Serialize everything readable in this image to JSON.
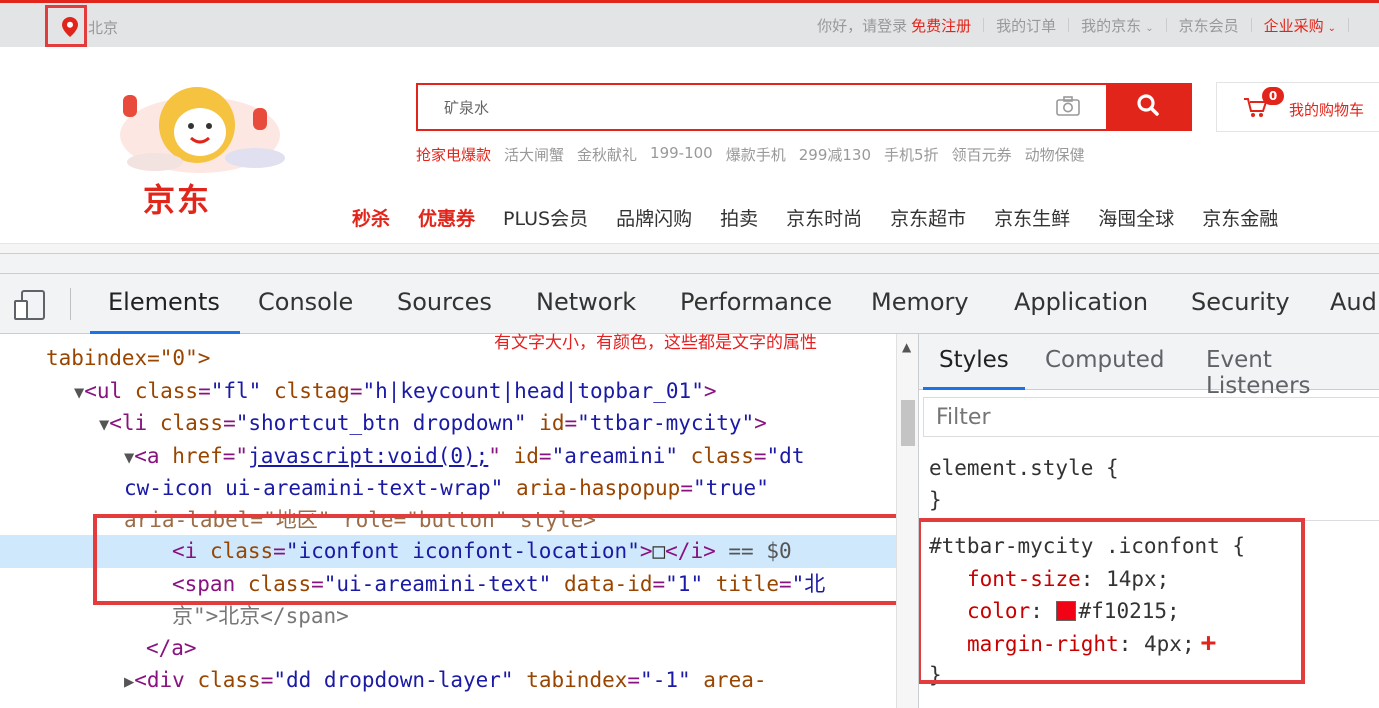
{
  "jd": {
    "city": "北京",
    "topnav": {
      "greeting": "你好，请登录",
      "register": "免费注册",
      "orders": "我的订单",
      "my_jd": "我的京东",
      "member": "京东会员",
      "enterprise": "企业采购"
    },
    "logo_text": "京东",
    "search": {
      "value": "矿泉水"
    },
    "cart": {
      "badge": "0",
      "label": "我的购物车"
    },
    "hotwords": [
      "抢家电爆款",
      "活大闸蟹",
      "金秋献礼",
      "199-100",
      "爆款手机",
      "299减130",
      "手机5折",
      "领百元券",
      "动物保健"
    ],
    "nav": [
      "秒杀",
      "优惠券",
      "PLUS会员",
      "品牌闪购",
      "拍卖",
      "京东时尚",
      "京东超市",
      "京东生鲜",
      "海囤全球",
      "京东金融"
    ]
  },
  "devtools": {
    "tabs": [
      "Elements",
      "Console",
      "Sources",
      "Network",
      "Performance",
      "Memory",
      "Application",
      "Security",
      "Audi"
    ],
    "annotation": "有文字大小，有颜色，这些都是文字的属性",
    "elements": {
      "l0": "tabindex=\"0\">",
      "ul_tag": "<ul",
      "ul_class_attr": "class",
      "ul_class_val": "\"fl\"",
      "ul_clstag_attr": "clstag",
      "ul_clstag_val": "\"h|keycount|head|topbar_01\"",
      "li_tag": "<li",
      "li_class_attr": "class",
      "li_class_val": "\"shortcut_btn dropdown\"",
      "li_id_attr": "id",
      "li_id_val": "\"ttbar-mycity\"",
      "a_tag": "<a",
      "a_href_attr": "href",
      "a_href_val": "javascript:void(0);",
      "a_id_attr": "id",
      "a_id_val": "\"areamini\"",
      "a_class_attr": "class",
      "a_class_val1": "\"dt",
      "a_class_val2": "cw-icon ui-areamini-text-wrap\"",
      "a_aria_attr": "aria-haspopup",
      "a_aria_val": "\"true\"",
      "a_label_line": "aria-label=\"地区\" role=\"button\" style>",
      "i_tag": "<i",
      "i_class_attr": "class",
      "i_class_val": "\"iconfont iconfont-location\"",
      "i_close": "></i>",
      "i_glyph": "",
      "i_eq": "== $0",
      "span_tag": "<span",
      "span_class_attr": "class",
      "span_class_val": "\"ui-areamini-text\"",
      "span_dataid_attr": "data-id",
      "span_dataid_val": "\"1\"",
      "span_title_attr": "title",
      "span_title_val": "\"北",
      "span_line2": "京\">北京</span>",
      "a_close": "</a>",
      "div_tag": "<div",
      "div_class_attr": "class",
      "div_class_val": "\"dd dropdown-layer\"",
      "div_tab_attr": "tabindex",
      "div_tab_val": "\"-1\"",
      "div_area": "area-"
    },
    "styles": {
      "tabs": [
        "Styles",
        "Computed",
        "Event Listeners"
      ],
      "filter_placeholder": "Filter",
      "element_style": "element.style {",
      "close_brace": "}",
      "selector": "#ttbar-mycity .iconfont {",
      "props": [
        {
          "name": "font-size",
          "value": "14px;"
        },
        {
          "name": "color",
          "value": "#f10215;"
        },
        {
          "name": "margin-right",
          "value": "4px;"
        }
      ]
    }
  },
  "colors": {
    "jd_red": "#e1251b",
    "icon_color": "#f10215",
    "highlight_box": "#e23c3c"
  }
}
